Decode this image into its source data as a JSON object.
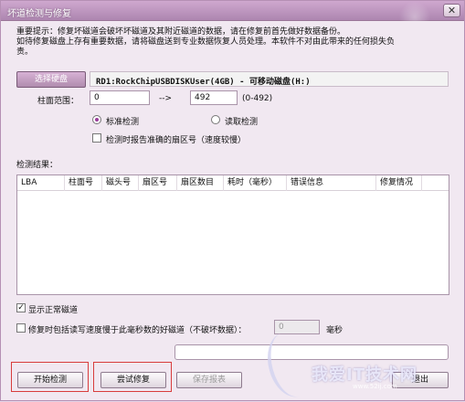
{
  "window": {
    "title": "坏道检测与修复",
    "close_glyph": "✕"
  },
  "notice": {
    "line1": "重要提示：修复坏磁道会破坏坏磁道及其附近磁道的数据，请在修复前首先做好数据备份。",
    "line2": "如待修复磁盘上存有重要数据，请将磁盘送到专业数据恢复人员处理。本软件不对由此带来的任何损失负",
    "line3": "责。"
  },
  "disk": {
    "select_label": "选择硬盘",
    "current": "RD1:RockChipUSBDISKUser(4GB) - 可移动磁盘(H:)"
  },
  "range": {
    "label": "柱面范围：",
    "from": "0",
    "arrow": "-->",
    "to": "492",
    "hint": "(0-492)"
  },
  "mode": {
    "standard_label": "标准检测",
    "standard_checked": true,
    "read_label": "读取检测",
    "read_checked": false,
    "report_sector_label": "检测时报告准确的扇区号（速度较慢）",
    "report_sector_checked": false
  },
  "results": {
    "label": "检测结果：",
    "columns": [
      "LBA",
      "柱面号",
      "磁头号",
      "扇区号",
      "扇区数目",
      "耗时（毫秒）",
      "错误信息",
      "修复情况"
    ]
  },
  "options": {
    "show_normal_label": "显示正常磁道",
    "show_normal_checked": true,
    "slow_repair_label": "修复时包括读写速度慢于此毫秒数的好磁道（不破坏数据）：",
    "slow_repair_checked": false,
    "ms_value": "0",
    "ms_unit": "毫秒"
  },
  "buttons": {
    "start": "开始检测",
    "repair": "尝试修复",
    "save": "保存报表",
    "exit": "退出"
  },
  "watermark": {
    "text": "我爱IT技术网",
    "url": "www.52ij.com"
  },
  "colors": {
    "accent": "#ad86b0",
    "highlight": "#d83c3c"
  }
}
